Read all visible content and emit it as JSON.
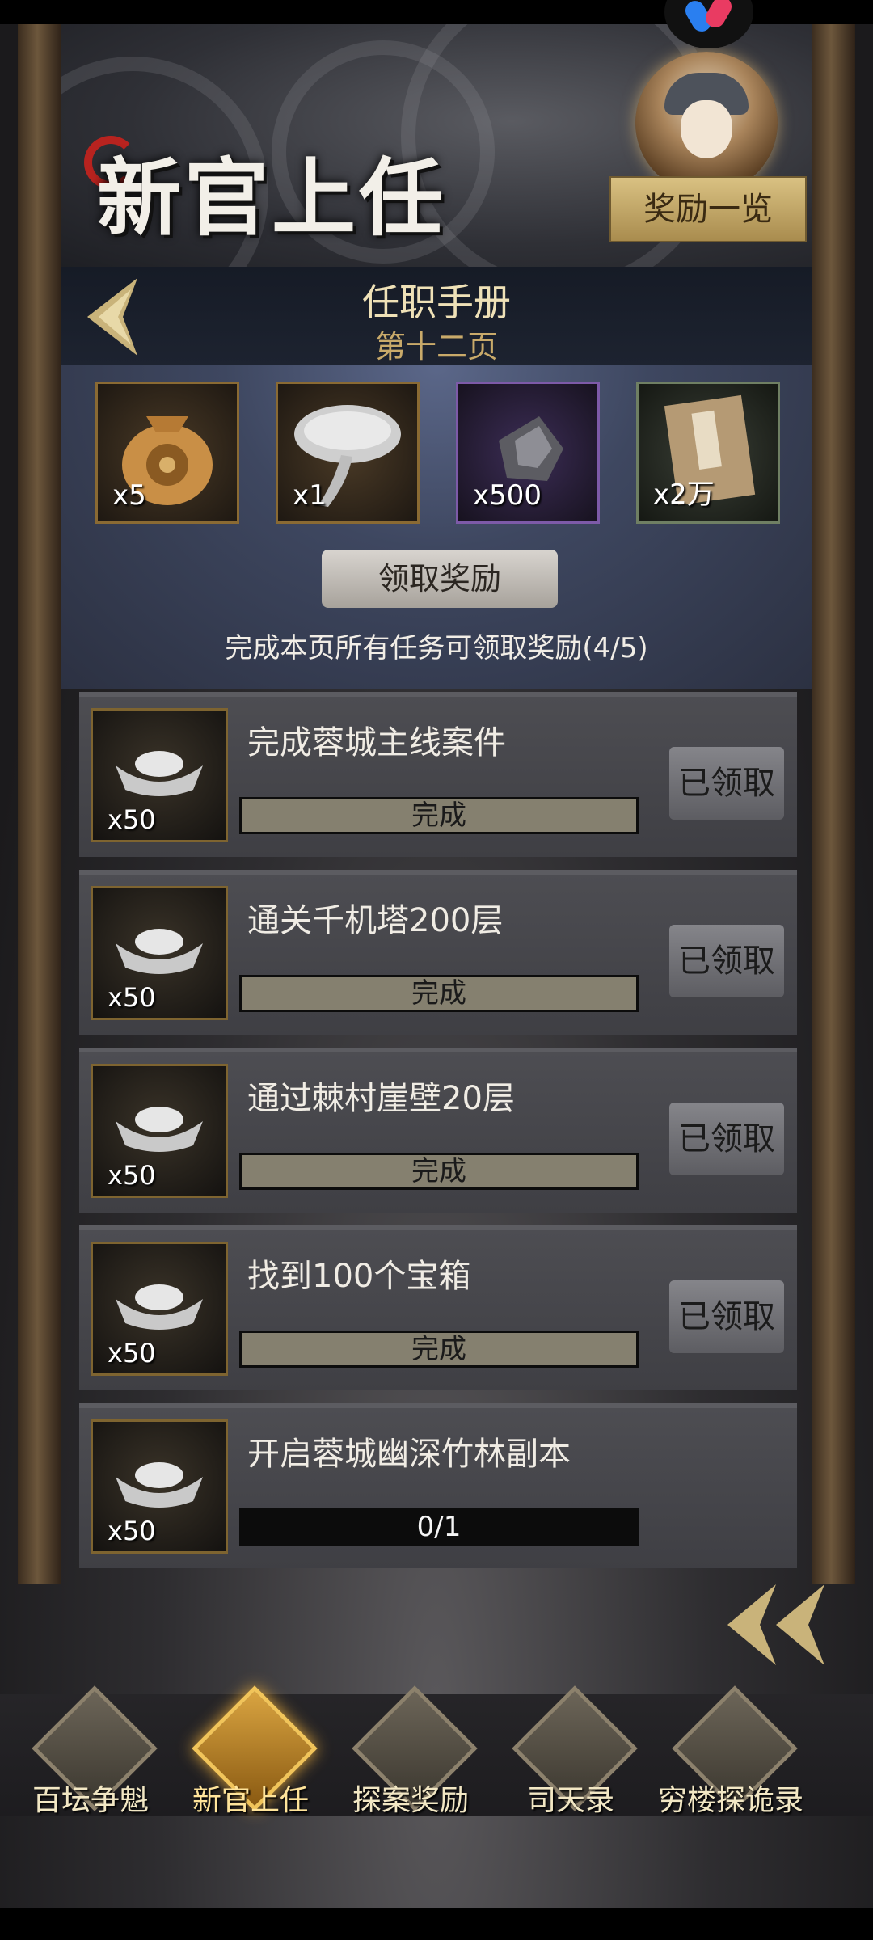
{
  "event": {
    "title": "新官上任",
    "reward_list_label": "奖励一览"
  },
  "handbook": {
    "title": "任职手册",
    "page": "第十二页"
  },
  "page_rewards": [
    {
      "icon": "coin-pouch-icon",
      "qty": "x5"
    },
    {
      "icon": "lingzhi-mushroom-icon",
      "qty": "x1"
    },
    {
      "icon": "ore-stone-icon",
      "qty": "x500"
    },
    {
      "icon": "martial-book-icon",
      "qty": "x2万"
    }
  ],
  "claim_button_label": "领取奖励",
  "progress_text": "完成本页所有任务可领取奖励(4/5)",
  "tasks": [
    {
      "name": "完成蓉城主线案件",
      "reward_qty": "x50",
      "progress_label": "完成",
      "progress": 1,
      "status": "已领取"
    },
    {
      "name": "通关千机塔200层",
      "reward_qty": "x50",
      "progress_label": "完成",
      "progress": 1,
      "status": "已领取"
    },
    {
      "name": "通过棘村崖壁20层",
      "reward_qty": "x50",
      "progress_label": "完成",
      "progress": 1,
      "status": "已领取"
    },
    {
      "name": "找到100个宝箱",
      "reward_qty": "x50",
      "progress_label": "完成",
      "progress": 1,
      "status": "已领取"
    },
    {
      "name": "开启蓉城幽深竹林副本",
      "reward_qty": "x50",
      "progress_label": "0/1",
      "progress": 0,
      "status": ""
    }
  ],
  "bottom_nav": [
    {
      "label": "百坛争魁",
      "active": false
    },
    {
      "label": "新官上任",
      "active": true
    },
    {
      "label": "探案奖励",
      "active": false
    },
    {
      "label": "司天录",
      "active": false
    },
    {
      "label": "穷楼探诡录",
      "active": false
    }
  ]
}
